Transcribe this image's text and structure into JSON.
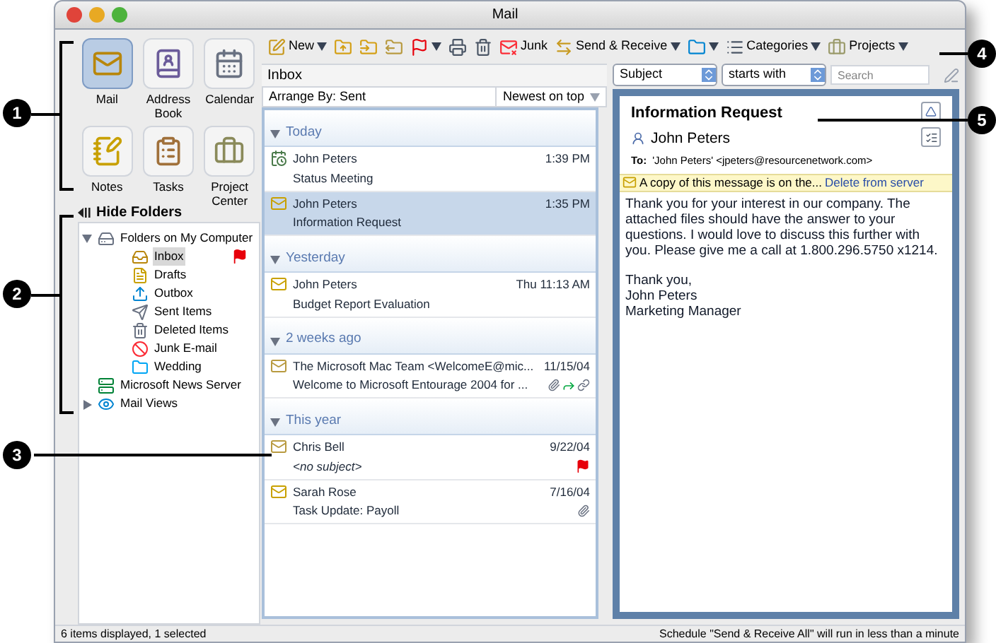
{
  "window": {
    "title": "Mail"
  },
  "modules": [
    {
      "kind": "mail",
      "label": "Mail",
      "selected": true
    },
    {
      "kind": "contacts",
      "label": "Address Book",
      "selected": false
    },
    {
      "kind": "calendar",
      "label": "Calendar",
      "selected": false
    },
    {
      "kind": "notes",
      "label": "Notes",
      "selected": false
    },
    {
      "kind": "tasks",
      "label": "Tasks",
      "selected": false
    },
    {
      "kind": "projects",
      "label": "Project Center",
      "selected": false
    }
  ],
  "folders_toggle": "Hide Folders",
  "folders": [
    {
      "kind": "computer",
      "label": "Folders on My Computer",
      "expanded": true,
      "selected": false,
      "flagged": false,
      "children": [
        {
          "kind": "inbox",
          "label": "Inbox",
          "selected": true,
          "flagged": true
        },
        {
          "kind": "drafts",
          "label": "Drafts",
          "selected": false,
          "flagged": false
        },
        {
          "kind": "outbox",
          "label": "Outbox",
          "selected": false,
          "flagged": false
        },
        {
          "kind": "sent",
          "label": "Sent Items",
          "selected": false,
          "flagged": false
        },
        {
          "kind": "deleted",
          "label": "Deleted Items",
          "selected": false,
          "flagged": false
        },
        {
          "kind": "junk",
          "label": "Junk E-mail",
          "selected": false,
          "flagged": false
        },
        {
          "kind": "folder",
          "label": "Wedding",
          "selected": false,
          "flagged": false
        }
      ]
    },
    {
      "kind": "news",
      "label": "Microsoft News Server",
      "selected": false,
      "flagged": false
    },
    {
      "kind": "views",
      "label": "Mail Views",
      "expanded": false,
      "selected": false,
      "flagged": false
    }
  ],
  "toolbar": [
    {
      "kind": "new",
      "label": "New",
      "menu": true
    },
    {
      "kind": "folder-up",
      "menu": false
    },
    {
      "kind": "folder-input",
      "menu": false
    },
    {
      "kind": "folder-output",
      "menu": false
    },
    {
      "kind": "flag",
      "menu": true
    },
    {
      "kind": "print",
      "menu": false
    },
    {
      "kind": "delete",
      "menu": false
    },
    {
      "kind": "junk",
      "label": "Junk",
      "menu": false
    },
    {
      "kind": "send-receive",
      "label": "Send & Receive",
      "menu": true
    },
    {
      "kind": "folder",
      "menu": true
    },
    {
      "kind": "categories",
      "label": "Categories",
      "menu": true
    },
    {
      "kind": "projects",
      "label": "Projects",
      "menu": true
    }
  ],
  "message_list": {
    "title": "Inbox",
    "arrange_by": "Arrange By: Sent",
    "sort": "Newest on top",
    "groups": [
      {
        "label": "Today",
        "expanded": true,
        "messages": [
          {
            "kind": "meeting",
            "sender": "John Peters",
            "date": "1:39 PM",
            "subject": "Status Meeting",
            "selected": false,
            "no_subject": false,
            "flagged": false,
            "attachment": false,
            "forwarded": false,
            "linked": false
          },
          {
            "kind": "partial",
            "sender": "John Peters",
            "date": "1:35 PM",
            "subject": "Information Request",
            "selected": true,
            "no_subject": false,
            "flagged": false,
            "attachment": false,
            "forwarded": false,
            "linked": false
          }
        ]
      },
      {
        "label": "Yesterday",
        "expanded": true,
        "messages": [
          {
            "kind": "partial",
            "sender": "John Peters",
            "date": "Thu 11:13 AM",
            "subject": "Budget Report Evaluation",
            "selected": false,
            "no_subject": false,
            "flagged": false,
            "attachment": false,
            "forwarded": false,
            "linked": false
          }
        ]
      },
      {
        "label": "2 weeks ago",
        "expanded": true,
        "messages": [
          {
            "kind": "read",
            "sender": "The Microsoft Mac Team <WelcomeE@mic...",
            "date": "11/15/04",
            "subject": "Welcome to Microsoft Entourage 2004 for ...",
            "selected": false,
            "no_subject": false,
            "flagged": false,
            "attachment": true,
            "forwarded": true,
            "linked": true
          }
        ]
      },
      {
        "label": "This year",
        "expanded": true,
        "messages": [
          {
            "kind": "read",
            "sender": "Chris Bell",
            "date": "9/22/04",
            "subject": "<no subject>",
            "selected": false,
            "no_subject": true,
            "flagged": true,
            "attachment": false,
            "forwarded": false,
            "linked": false
          },
          {
            "kind": "partial",
            "sender": "Sarah Rose",
            "date": "7/16/04",
            "subject": "Task Update: Payoll",
            "selected": false,
            "no_subject": false,
            "flagged": false,
            "attachment": true,
            "forwarded": false,
            "linked": false
          }
        ]
      }
    ]
  },
  "filter": {
    "field": "Subject",
    "operator": "starts with",
    "search": {
      "placeholder": "Search"
    }
  },
  "preview": {
    "subject": "Information Request",
    "from": "John Peters",
    "to_label": "To:",
    "to": "'John Peters' <jpeters@resourcenetwork.com>",
    "notice": "A copy of this message is on the...",
    "notice_link": "Delete from server",
    "body": [
      "Thank you for your interest in our company. The attached files should have the answer to your questions. I would love to discuss this further with you. Please give me a call at 1.800.296.5750 x1214.",
      "Thank you,\nJohn Peters\nMarketing Manager"
    ]
  },
  "status_bar": {
    "left": "6 items displayed, 1 selected",
    "right": "Schedule \"Send & Receive All\" will run in less than a minute"
  },
  "callouts": [
    {
      "number": "1"
    },
    {
      "number": "2"
    },
    {
      "number": "3"
    },
    {
      "number": "4"
    },
    {
      "number": "5"
    }
  ]
}
